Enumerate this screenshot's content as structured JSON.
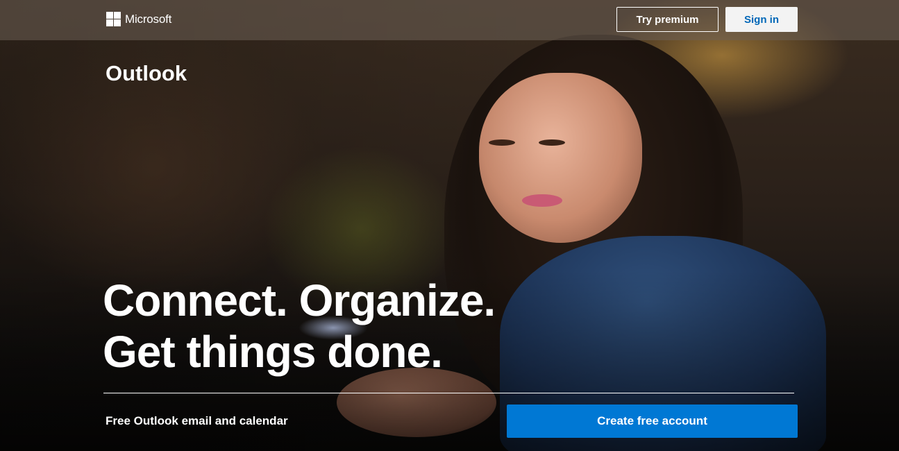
{
  "header": {
    "logo_text": "Microsoft",
    "try_premium_label": "Try premium",
    "sign_in_label": "Sign in"
  },
  "hero": {
    "product_name": "Outlook",
    "headline_line1": "Connect. Organize.",
    "headline_line2": "Get things done.",
    "tagline": "Free Outlook email and calendar",
    "cta_label": "Create free account"
  },
  "colors": {
    "accent": "#0078d4",
    "link": "#0067b8",
    "signin_bg": "#f3f3f3",
    "text": "#ffffff"
  },
  "icons": {
    "logo": "microsoft-logo-icon"
  }
}
